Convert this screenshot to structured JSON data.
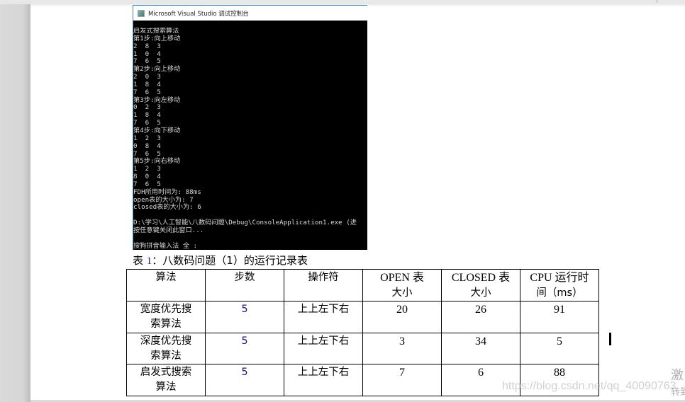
{
  "console": {
    "title": "Microsoft Visual Studio 调试控制台",
    "lines": [
      "启发式搜索算法",
      "第1步:向上移动",
      "2  8  3",
      "1  0  4",
      "7  6  5",
      "第2步:向上移动",
      "2  0  3",
      "1  8  4",
      "7  6  5",
      "第3步:向左移动",
      "0  2  3",
      "1  8  4",
      "7  6  5",
      "第4步:向下移动",
      "1  2  3",
      "0  8  4",
      "7  6  5",
      "第5步:向右移动",
      "1  2  3",
      "8  0  4",
      "7  6  5",
      "FDH所用时间为: 88ms",
      "open表的大小为: 7",
      "closed表的大小为: 6",
      "",
      "D:\\学习\\人工智能\\八数码问题\\Debug\\ConsoleApplication1.exe (进",
      "按任意键关闭此窗口...",
      "",
      "搜狗拼音输入法 全 :"
    ]
  },
  "caption": {
    "prefix": "表 ",
    "number": "1",
    "text": "：八数码问题（1）的运行记录表"
  },
  "table": {
    "headers": [
      [
        "算法",
        ""
      ],
      [
        "步数",
        ""
      ],
      [
        "操作符",
        ""
      ],
      [
        "OPEN 表",
        "大小"
      ],
      [
        "CLOSED 表",
        "大小"
      ],
      [
        "CPU 运行时",
        "间（ms）"
      ]
    ],
    "rows": [
      {
        "algorithm": [
          "宽度优先搜",
          "索算法"
        ],
        "steps": "5",
        "operators": "上上左下右",
        "open": "20",
        "closed": "26",
        "cpu_ms": "91"
      },
      {
        "algorithm": [
          "深度优先搜",
          "索算法"
        ],
        "steps": "5",
        "operators": "上上左下右",
        "open": "3",
        "closed": "34",
        "cpu_ms": "5"
      },
      {
        "algorithm": [
          "启发式搜索",
          "算法"
        ],
        "steps": "5",
        "operators": "上上左下右",
        "open": "7",
        "closed": "6",
        "cpu_ms": "88"
      }
    ]
  },
  "watermark": "https://blog.csdn.net/qq_40090763",
  "side_text": [
    "激",
    "转到"
  ]
}
